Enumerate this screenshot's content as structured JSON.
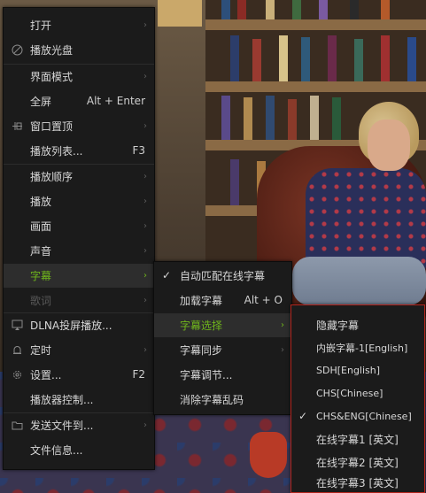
{
  "main_menu": {
    "items": [
      {
        "label": "打开",
        "arrow": "›"
      },
      {
        "label": "播放光盘"
      },
      {
        "label": "界面模式",
        "arrow": "›"
      },
      {
        "label": "全屏",
        "shortcut": "Alt + Enter"
      },
      {
        "label": "窗口置顶",
        "arrow": "›"
      },
      {
        "label": "播放列表...",
        "shortcut": "F3"
      },
      {
        "label": "播放顺序",
        "arrow": "›"
      },
      {
        "label": "播放",
        "arrow": "›"
      },
      {
        "label": "画面",
        "arrow": "›"
      },
      {
        "label": "声音",
        "arrow": "›"
      },
      {
        "label": "字幕",
        "arrow": "›"
      },
      {
        "label": "歌词",
        "arrow": "›"
      },
      {
        "label": "DLNA投屏播放..."
      },
      {
        "label": "定时",
        "arrow": "›"
      },
      {
        "label": "设置...",
        "shortcut": "F2"
      },
      {
        "label": "播放器控制..."
      },
      {
        "label": "发送文件到...",
        "arrow": "›"
      },
      {
        "label": "文件信息..."
      }
    ]
  },
  "subtitle_menu": {
    "items": [
      {
        "label": "自动匹配在线字幕",
        "check": "✓"
      },
      {
        "label": "加载字幕",
        "shortcut": "Alt + O"
      },
      {
        "label": "字幕选择",
        "arrow": "›"
      },
      {
        "label": "字幕同步",
        "arrow": "›"
      },
      {
        "label": "字幕调节..."
      },
      {
        "label": "消除字幕乱码"
      }
    ]
  },
  "subtitle_select_menu": {
    "items": [
      {
        "label": "隐藏字幕"
      },
      {
        "label": "内嵌字幕-1[English]"
      },
      {
        "label": "SDH[English]"
      },
      {
        "label": "CHS[Chinese]"
      },
      {
        "label": "CHS&ENG[Chinese]",
        "check": "✓"
      },
      {
        "label": "在线字幕1 [英文]"
      },
      {
        "label": "在线字幕2 [英文]"
      },
      {
        "label": "在线字幕3 [英文]"
      }
    ]
  },
  "colors": {
    "menu_bg": "#1b1b1b",
    "highlight_text": "#6fb51c",
    "submenu_border": "#b3261e"
  }
}
